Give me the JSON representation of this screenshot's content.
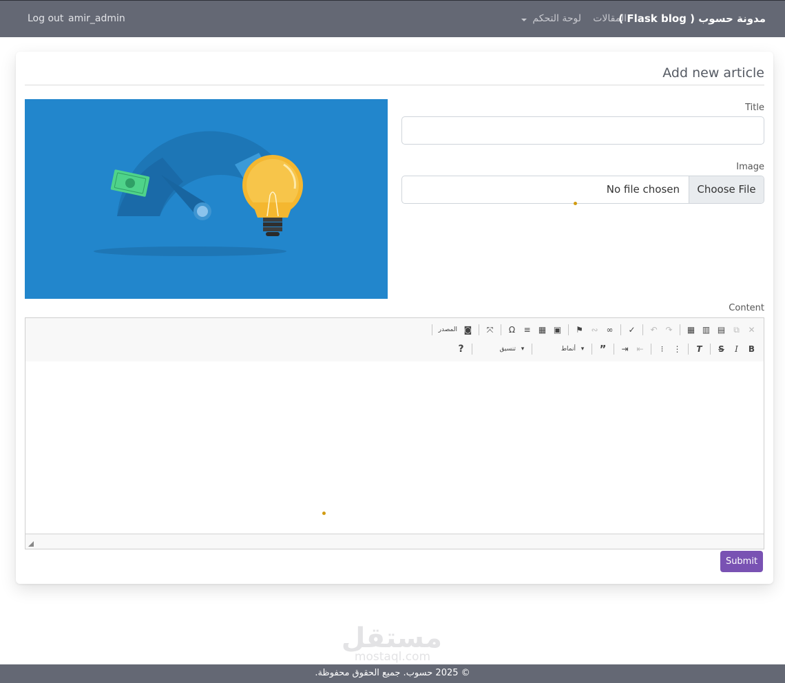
{
  "navbar": {
    "brand": "مدونة حسوب ( Flask blog )",
    "articles": "المقالات",
    "dashboard": "لوحة التحكم",
    "username": "amir_admin",
    "logout": "Log out"
  },
  "form": {
    "heading": "Add new article",
    "title_label": "Title",
    "title_value": "",
    "image_label": "Image",
    "file_button": "Choose File",
    "file_status": "No file chosen",
    "content_label": "Content",
    "submit": "Submit"
  },
  "editor": {
    "source_label": "المصدر",
    "styles_label": "أنماط",
    "format_label": "تنسيق",
    "toolbar_row1": [
      "cut-icon",
      "copy-icon",
      "paste-icon",
      "paste-text-icon",
      "paste-word-icon",
      "undo-icon",
      "redo-icon",
      "spellcheck-icon",
      "link-icon",
      "unlink-icon",
      "anchor-icon",
      "image-icon",
      "table-icon",
      "horizontal-rule-icon",
      "special-char-icon",
      "maximize-icon",
      "source-icon"
    ],
    "toolbar_row2": [
      "bold-icon",
      "italic-icon",
      "strikethrough-icon",
      "remove-format-icon",
      "numbered-list-icon",
      "bulleted-list-icon",
      "outdent-icon",
      "indent-icon",
      "blockquote-icon",
      "styles-combo",
      "format-combo",
      "help-icon"
    ]
  },
  "watermark": {
    "arabic": "مستقل",
    "latin": "mostaql.com"
  },
  "footer": {
    "copyright": "© 2025 حسوب. جميع الحقوق محفوظة."
  },
  "colors": {
    "navbar": "#646874",
    "submit": "#7952b3",
    "preview_bg": "#2286cc",
    "bulb": "#f4b730"
  }
}
